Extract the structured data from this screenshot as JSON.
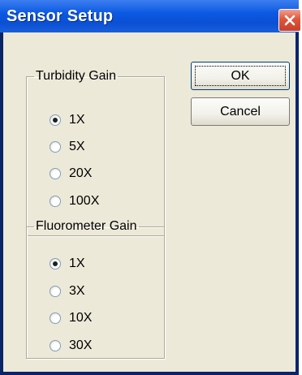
{
  "window": {
    "title": "Sensor Setup"
  },
  "turbidity": {
    "legend": "Turbidity Gain",
    "options": [
      "1X",
      "5X",
      "20X",
      "100X"
    ],
    "selected": "1X"
  },
  "fluorometer": {
    "legend": "Fluorometer Gain",
    "options": [
      "1X",
      "3X",
      "10X",
      "30X"
    ],
    "selected": "1X"
  },
  "buttons": {
    "ok": "OK",
    "cancel": "Cancel"
  },
  "colors": {
    "titlebar": "#0b5ae2",
    "dialog_face": "#ece9d8",
    "close_button": "#e0553a"
  }
}
